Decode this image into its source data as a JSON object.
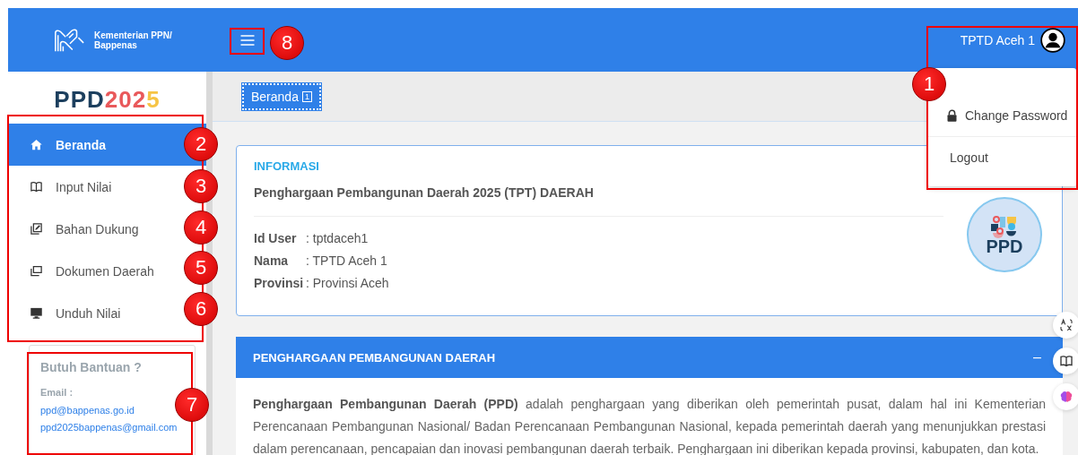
{
  "header": {
    "org_lines": [
      "Kementerian PPN/",
      "Bappenas"
    ],
    "user_name": "TPTD Aceh 1"
  },
  "user_menu": {
    "items": [
      {
        "label": "Change Password",
        "kind": "lock"
      },
      {
        "label": "Logout",
        "kind": "plain"
      }
    ]
  },
  "sidebar": {
    "logo": [
      {
        "text": "PPD",
        "color": "#1c3f5e"
      },
      {
        "text": "202",
        "color": "#e9595b"
      },
      {
        "text": "5",
        "color": "#f6c445"
      }
    ],
    "items": [
      {
        "label": "Beranda",
        "kind": "home",
        "selected": true
      },
      {
        "label": "Input Nilai",
        "kind": "book",
        "selected": false
      },
      {
        "label": "Bahan Dukung",
        "kind": "edit",
        "selected": false
      },
      {
        "label": "Dokumen Daerah",
        "kind": "copies",
        "selected": false
      },
      {
        "label": "Unduh Nilai",
        "kind": "monitor",
        "selected": false
      }
    ],
    "help": {
      "title": "Butuh Bantuan ?",
      "email_label": "Email :",
      "emails": [
        "ppd@bappenas.go.id",
        "ppd2025bappenas@gmail.com"
      ]
    }
  },
  "breadcrumb": {
    "label": "Beranda",
    "badge": "1"
  },
  "info_card": {
    "heading": "INFORMASI",
    "title": "Penghargaan Pembangunan Daerah 2025 (TPT) DAERAH",
    "fields": [
      {
        "label": "Id User",
        "value": ": tptdaceh1"
      },
      {
        "label": "Nama",
        "value": ": TPTD Aceh 1"
      },
      {
        "label": "Provinsi",
        "value": ": Provinsi Aceh"
      }
    ],
    "logo_text": "PPD"
  },
  "section": {
    "title": "PENGHARGAAN PEMBANGUNAN DAERAH",
    "collapse": "–",
    "text": "**Penghargaan Pembangunan Daerah (PPD)** adalah penghargaan yang diberikan oleh pemerintah pusat, dalam hal ini Kementerian Perencanaan Pembangunan Nasional/ Badan Perencanaan Pembangunan Nasional, kepada pemerintah daerah yang menunjukkan prestasi dalam perencanaan, pencapaian dan inovasi pembangunan daerah terbaik. Penghargaan ini diberikan kepada provinsi, kabupaten, dan kota."
  },
  "callouts": [
    "1",
    "2",
    "3",
    "4",
    "5",
    "6",
    "7",
    "8"
  ]
}
